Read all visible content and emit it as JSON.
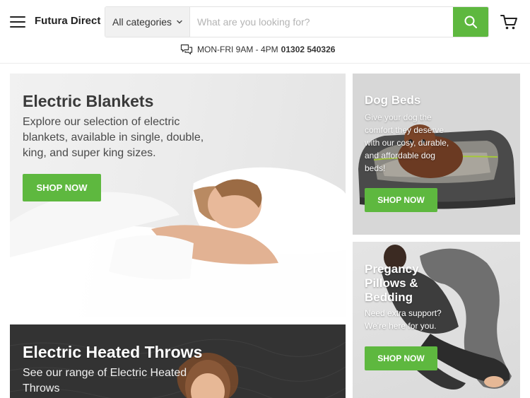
{
  "header": {
    "logo": "Futura Direct",
    "category_select": "All categories",
    "search_placeholder": "What are you looking for?",
    "phone_hours": "MON-FRI 9AM - 4PM",
    "phone_number": "01302 540326"
  },
  "tiles": {
    "blankets": {
      "title": "Electric Blankets",
      "description": "Explore our selection of electric blankets, available in single, double, king, and super king sizes.",
      "button": "SHOP NOW"
    },
    "dog_beds": {
      "title": "Dog Beds",
      "description": "Give your dog the comfort they deserve with our cosy, durable, and affordable dog beds!",
      "button": "SHOP NOW"
    },
    "pillows": {
      "title": "Pregancy Pillows & Bedding",
      "description": "Need extra support? We're here for you.",
      "button": "SHOP NOW"
    },
    "throws": {
      "title": "Electric Heated Throws",
      "description": "See our range of Electric Heated Throws"
    }
  },
  "colors": {
    "accent": "#5eb83f",
    "text_dark": "#222222"
  },
  "icons": [
    "menu-icon",
    "chevron-down-icon",
    "search-icon",
    "cart-icon",
    "chat-icon"
  ]
}
